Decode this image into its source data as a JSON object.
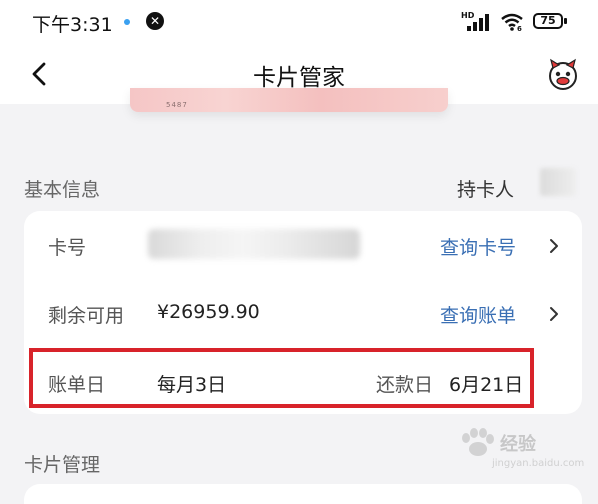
{
  "status_bar": {
    "time": "下午3:31",
    "network_label": "HD",
    "wifi_label": "6",
    "battery": "75"
  },
  "nav": {
    "title": "卡片管家"
  },
  "card": {
    "digits": "5487"
  },
  "basic_info": {
    "section_title": "基本信息",
    "holder_label": "持卡人"
  },
  "rows": {
    "card_number": {
      "label": "卡号",
      "link": "查询卡号"
    },
    "available": {
      "label": "剩余可用",
      "value": "¥26959.90",
      "link": "查询账单"
    },
    "billing": {
      "label": "账单日",
      "value": "每月3日",
      "repay_label": "还款日",
      "repay_value": "6月21日"
    }
  },
  "card_manage": {
    "section_title": "卡片管理"
  },
  "watermark": {
    "text": "经验",
    "sub": "jingyan.baidu.com"
  },
  "colors": {
    "link": "#3a6fb4",
    "highlight": "#d8232a",
    "background": "#f3f3f5"
  }
}
